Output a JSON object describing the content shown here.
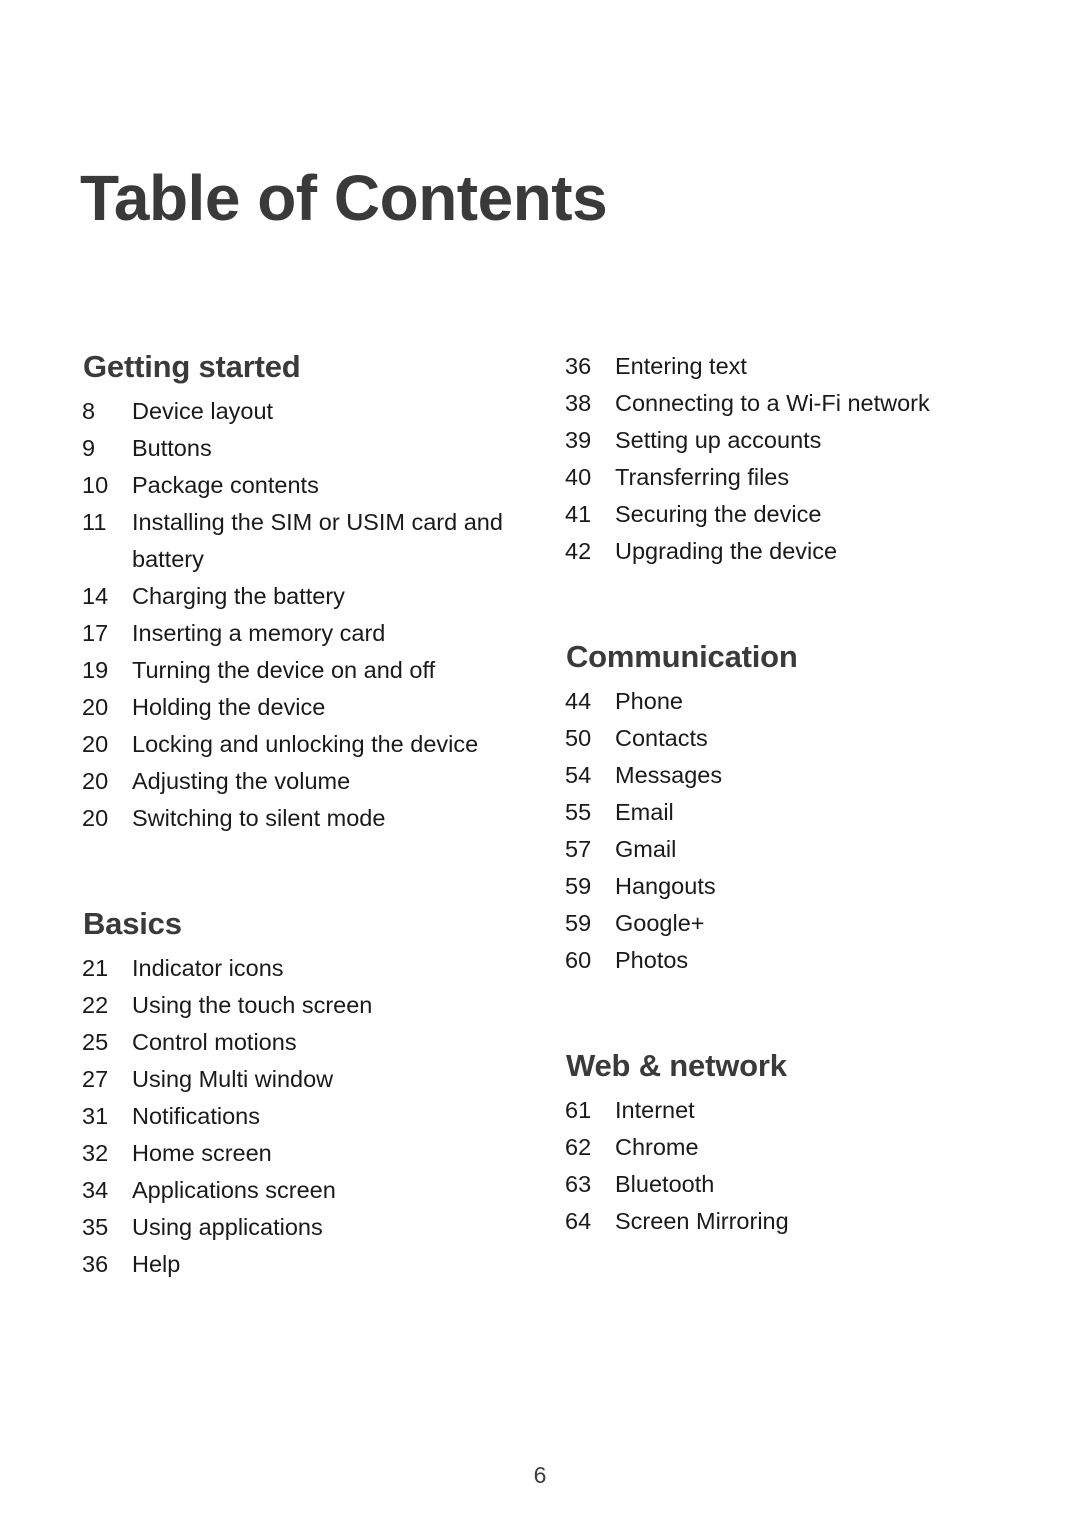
{
  "document": {
    "title": "Table of Contents",
    "folio": "6"
  },
  "columns": {
    "left": [
      {
        "heading": "Getting started",
        "show_heading": true,
        "entries": [
          {
            "page": "8",
            "title": "Device layout"
          },
          {
            "page": "9",
            "title": "Buttons"
          },
          {
            "page": "10",
            "title": "Package contents"
          },
          {
            "page": "11",
            "title": "Installing the SIM or USIM card and battery"
          },
          {
            "page": "14",
            "title": "Charging the battery"
          },
          {
            "page": "17",
            "title": "Inserting a memory card"
          },
          {
            "page": "19",
            "title": "Turning the device on and off"
          },
          {
            "page": "20",
            "title": "Holding the device"
          },
          {
            "page": "20",
            "title": "Locking and unlocking the device"
          },
          {
            "page": "20",
            "title": "Adjusting the volume"
          },
          {
            "page": "20",
            "title": "Switching to silent mode"
          }
        ]
      },
      {
        "heading": "Basics",
        "show_heading": true,
        "entries": [
          {
            "page": "21",
            "title": "Indicator icons"
          },
          {
            "page": "22",
            "title": "Using the touch screen"
          },
          {
            "page": "25",
            "title": "Control motions"
          },
          {
            "page": "27",
            "title": "Using Multi window"
          },
          {
            "page": "31",
            "title": "Notifications"
          },
          {
            "page": "32",
            "title": "Home screen"
          },
          {
            "page": "34",
            "title": "Applications screen"
          },
          {
            "page": "35",
            "title": "Using applications"
          },
          {
            "page": "36",
            "title": "Help"
          }
        ]
      }
    ],
    "right": [
      {
        "heading": "",
        "show_heading": false,
        "entries": [
          {
            "page": "36",
            "title": "Entering text"
          },
          {
            "page": "38",
            "title": "Connecting to a Wi-Fi network"
          },
          {
            "page": "39",
            "title": "Setting up accounts"
          },
          {
            "page": "40",
            "title": "Transferring files"
          },
          {
            "page": "41",
            "title": "Securing the device"
          },
          {
            "page": "42",
            "title": "Upgrading the device"
          }
        ]
      },
      {
        "heading": "Communication",
        "show_heading": true,
        "entries": [
          {
            "page": "44",
            "title": "Phone"
          },
          {
            "page": "50",
            "title": "Contacts"
          },
          {
            "page": "54",
            "title": "Messages"
          },
          {
            "page": "55",
            "title": "Email"
          },
          {
            "page": "57",
            "title": "Gmail"
          },
          {
            "page": "59",
            "title": "Hangouts"
          },
          {
            "page": "59",
            "title": "Google+"
          },
          {
            "page": "60",
            "title": "Photos"
          }
        ]
      },
      {
        "heading": "Web & network",
        "show_heading": true,
        "entries": [
          {
            "page": "61",
            "title": "Internet"
          },
          {
            "page": "62",
            "title": "Chrome"
          },
          {
            "page": "63",
            "title": "Bluetooth"
          },
          {
            "page": "64",
            "title": "Screen Mirroring"
          }
        ]
      }
    ]
  },
  "colors": {
    "heading": "#3a3a3a",
    "body": "#1a1a1a",
    "background": "#ffffff"
  }
}
